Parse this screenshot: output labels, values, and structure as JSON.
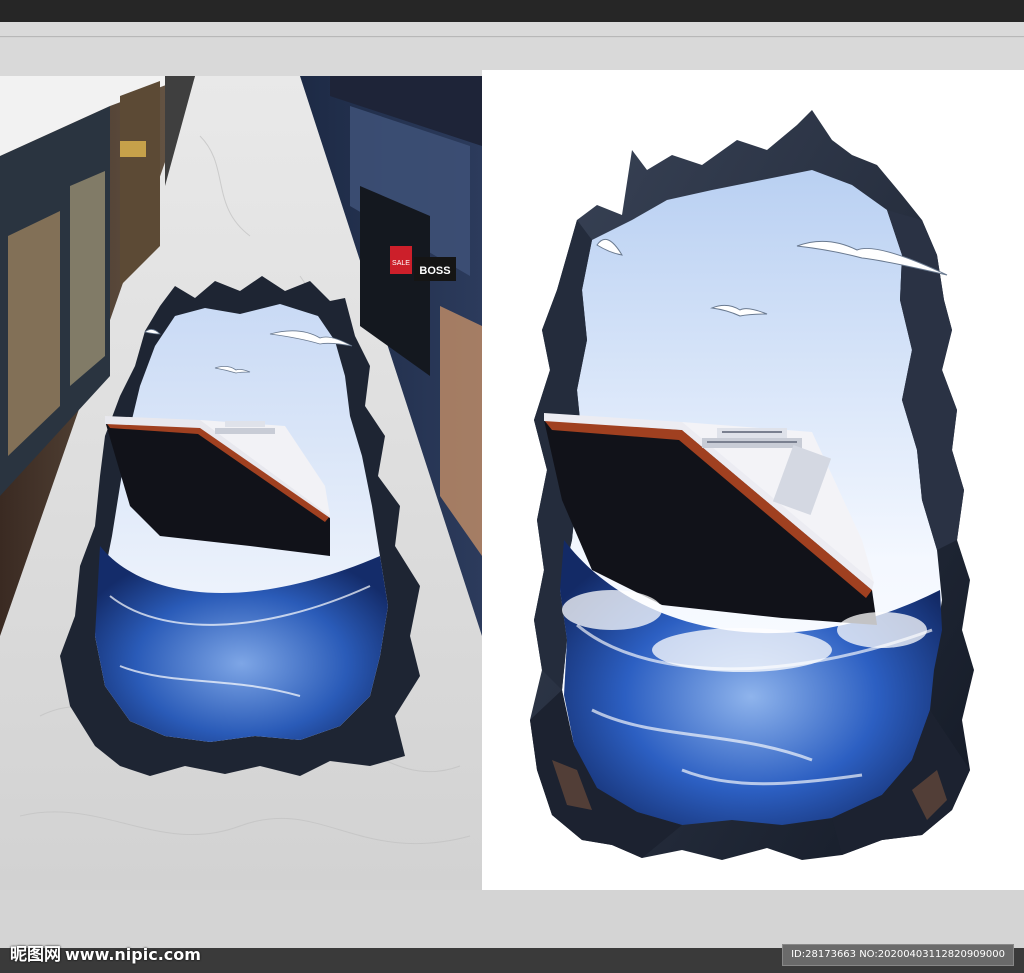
{
  "store_signs": {
    "sale": "SALE",
    "brand": "BOSS"
  },
  "watermark": {
    "logo_text": "昵图网",
    "url": "www.nipic.com",
    "id_text": "ID:28173663 NO:20200403112820909000"
  },
  "colors": {
    "topbar": "#262626",
    "canvas": "#d9d9d9",
    "ocean_deep": "#1a3f8f",
    "ocean_light": "#8fb4ec",
    "rock": "#1e2533",
    "hull": "#111219",
    "hull_stripe": "#a04020"
  },
  "icons": {
    "seagull": "seagull-icon",
    "ship": "cruise-ship-icon"
  }
}
